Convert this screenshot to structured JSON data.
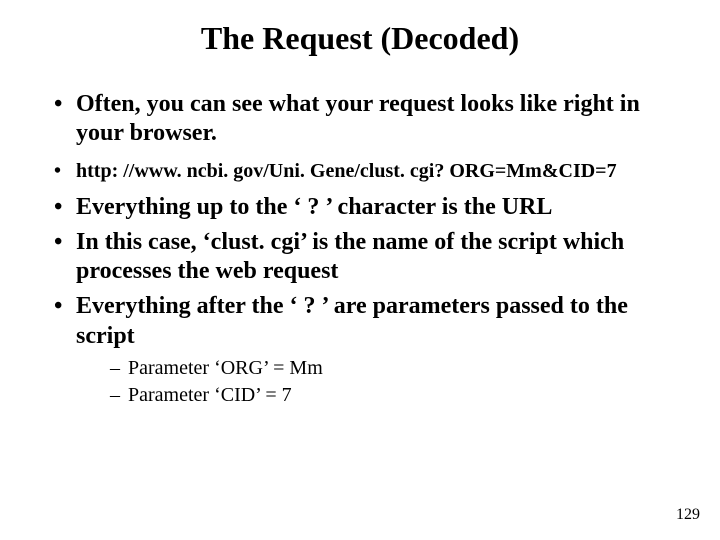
{
  "title": "The Request (Decoded)",
  "bullets": {
    "b1": "Often, you can see what your request looks like right in your browser.",
    "b2": "http: //www. ncbi. gov/Uni. Gene/clust. cgi? ORG=Mm&CID=7",
    "b3": "Everything up to the ‘ ? ’ character is the URL",
    "b4": "In this case, ‘clust. cgi’ is the name of the script which processes the web request",
    "b5": "Everything after the ‘ ? ’ are parameters passed to the script",
    "sub1": "Parameter ‘ORG’ = Mm",
    "sub2": "Parameter ‘CID’  = 7"
  },
  "page_number": "129"
}
